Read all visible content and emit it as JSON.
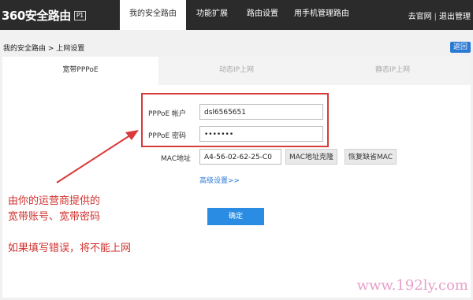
{
  "header": {
    "logo_text": "360安全路由",
    "logo_badge": "P1",
    "tabs": [
      {
        "label": "我的安全路由"
      },
      {
        "label": "功能扩展"
      },
      {
        "label": "路由设置"
      },
      {
        "label": "用手机管理路由"
      }
    ],
    "links": {
      "official": "去官网",
      "separator": "|",
      "logout": "退出管理"
    }
  },
  "breadcrumb": {
    "text": "我的安全路由 > 上网设置",
    "back_label": "返回"
  },
  "connection_tabs": [
    {
      "label": "宽带PPPoE"
    },
    {
      "label": "动态IP上网"
    },
    {
      "label": "静态IP上网"
    }
  ],
  "form": {
    "account_label": "PPPoE 帐户",
    "account_value": "dsl6565651",
    "password_label": "PPPoE 密码",
    "password_value": "•••••••",
    "mac_label": "MAC地址",
    "mac_value": "A4-56-02-62-25-C0",
    "mac_clone_label": "MAC地址克隆",
    "mac_restore_label": "恢复缺省MAC",
    "advanced_label": "高级设置>>",
    "confirm_label": "确定"
  },
  "annotation": {
    "line1": "由你的运营商提供的",
    "line2": "宽带账号、宽带密码",
    "line3": "如果填写错误，将不能上网",
    "color": "#d0312d"
  },
  "watermark": "www.192ly.com",
  "colors": {
    "accent": "#2a8de3",
    "topbar": "#2b2b2b",
    "highlight": "#d93a3a"
  }
}
